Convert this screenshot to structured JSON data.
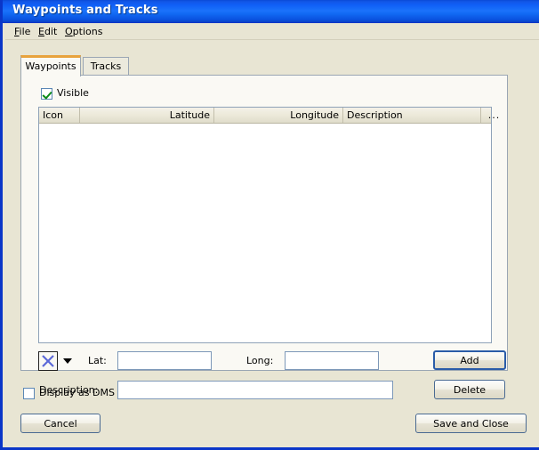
{
  "window": {
    "title": "Waypoints and Tracks",
    "accent_title_blue": "#0a4ad6",
    "frame_border": "#0a36c8",
    "face": "#e8e5d3"
  },
  "menubar": {
    "items": [
      {
        "label": "File",
        "mnemonic": "F"
      },
      {
        "label": "Edit",
        "mnemonic": "E"
      },
      {
        "label": "Options",
        "mnemonic": "O"
      }
    ]
  },
  "tabs": {
    "active_index": 0,
    "active_indicator_color": "#e8a33d",
    "items": [
      {
        "label": "Waypoints"
      },
      {
        "label": "Tracks"
      }
    ]
  },
  "waypoints_tab": {
    "visible_checkbox": {
      "label": "Visible",
      "checked": true,
      "check_color": "#0b8a17"
    },
    "grid": {
      "columns": [
        {
          "label": "Icon",
          "align": "left"
        },
        {
          "label": "Latitude",
          "align": "right"
        },
        {
          "label": "Longitude",
          "align": "right"
        },
        {
          "label": "Description",
          "align": "left"
        },
        {
          "label": "...",
          "align": "center"
        }
      ],
      "rows": []
    },
    "icon_picker": {
      "selected_icon": "x-cross-icon",
      "icon_color": "#5b68d8"
    },
    "fields": {
      "lat_label": "Lat:",
      "lat_value": "",
      "lat_placeholder": "",
      "long_label": "Long:",
      "long_value": "",
      "long_placeholder": "",
      "description_label": "Description:",
      "description_value": "",
      "description_placeholder": ""
    },
    "buttons": {
      "add_label": "Add",
      "add_focused": true,
      "delete_label": "Delete"
    }
  },
  "footer": {
    "dms_checkbox": {
      "label": "Display as DMS",
      "checked": false
    },
    "cancel_label": "Cancel",
    "save_label": "Save and Close"
  }
}
